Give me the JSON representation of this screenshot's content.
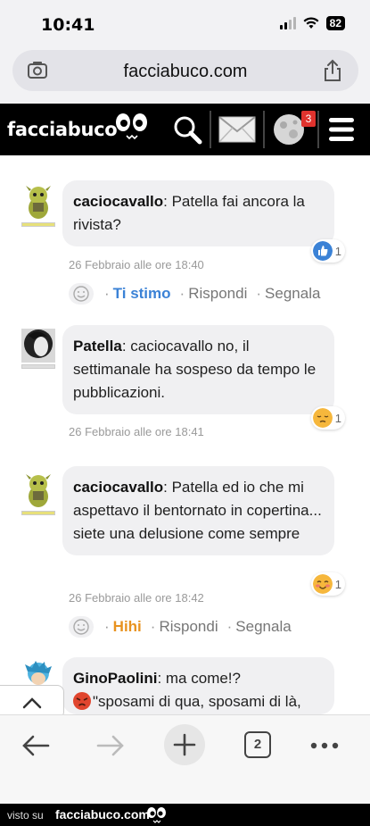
{
  "status": {
    "time": "10:41",
    "battery": "82"
  },
  "browser": {
    "url": "facciabuco.com",
    "tabs_count": "2"
  },
  "site": {
    "logo": "facciabuco",
    "notifications": "3"
  },
  "comments": [
    {
      "author": "caciocavallo",
      "text": ": Patella fai ancora la rivista?",
      "reaction_count": "1",
      "timestamp": "26 Febbraio alle ore 18:40",
      "actions": {
        "reaction_label": "Ti stimo",
        "reply": "Rispondi",
        "report": "Segnala"
      }
    },
    {
      "author": "Patella",
      "text": ": caciocavallo no, il settimanale ha sospeso da tempo le pubblicazioni.",
      "reaction_count": "1",
      "timestamp": "26 Febbraio alle ore 18:41"
    },
    {
      "author": "caciocavallo",
      "text": ": Patella ed io che mi aspettavo il bentornato in copertina... siete una delusione come sempre",
      "reaction_count": "1",
      "timestamp": "26 Febbraio alle ore 18:42",
      "actions": {
        "reaction_label": "Hihi",
        "reply": "Rispondi",
        "report": "Segnala"
      }
    },
    {
      "author": "GinoPaolini",
      "text": ": ma come!?",
      "text2": "\"sposami di qua, sposami di là,"
    }
  ],
  "footer": {
    "visto": "visto su",
    "site": "facciabuco.com"
  },
  "colors": {
    "ti_stimo": "#3b82d6",
    "hihi": "#e8921f",
    "header_bg": "#000000"
  }
}
